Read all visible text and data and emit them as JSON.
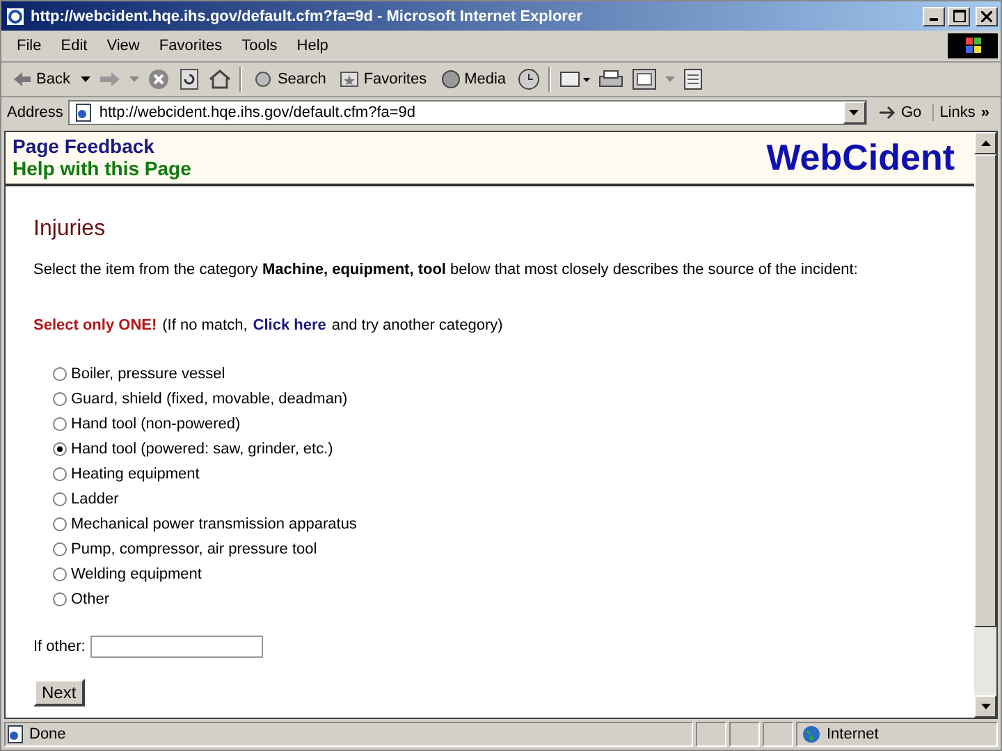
{
  "window": {
    "title": "http://webcident.hqe.ihs.gov/default.cfm?fa=9d - Microsoft Internet Explorer"
  },
  "menu": [
    "File",
    "Edit",
    "View",
    "Favorites",
    "Tools",
    "Help"
  ],
  "toolbar": {
    "back": "Back",
    "search": "Search",
    "favorites": "Favorites",
    "media": "Media"
  },
  "address": {
    "label": "Address",
    "url": "http://webcident.hqe.ihs.gov/default.cfm?fa=9d",
    "go": "Go",
    "links": "Links",
    "more": "»"
  },
  "page": {
    "feedback": "Page Feedback",
    "help": "Help with this Page",
    "logo": "WebCident",
    "heading": "Injuries",
    "instruction": "Select the item from the category **Machine, equipment, tool** below that most closely describes the source of the incident:",
    "warning": "Select only ONE!",
    "note_before": "(If no match,",
    "link": "Click here",
    "note_after": "and try another category)",
    "options": [
      {
        "label": "Boiler, pressure vessel",
        "selected": false
      },
      {
        "label": "Guard, shield (fixed, movable, deadman)",
        "selected": false
      },
      {
        "label": "Hand tool (non-powered)",
        "selected": false
      },
      {
        "label": "Hand tool (powered: saw, grinder, etc.)",
        "selected": true
      },
      {
        "label": "Heating equipment",
        "selected": false
      },
      {
        "label": "Ladder",
        "selected": false
      },
      {
        "label": "Mechanical power transmission apparatus",
        "selected": false
      },
      {
        "label": "Pump, compressor, air pressure tool",
        "selected": false
      },
      {
        "label": "Welding equipment",
        "selected": false
      },
      {
        "label": "Other",
        "selected": false
      }
    ],
    "other_label": "If other:",
    "next": "Next"
  },
  "status_bar": {
    "text": "Done",
    "zone": "Internet"
  }
}
